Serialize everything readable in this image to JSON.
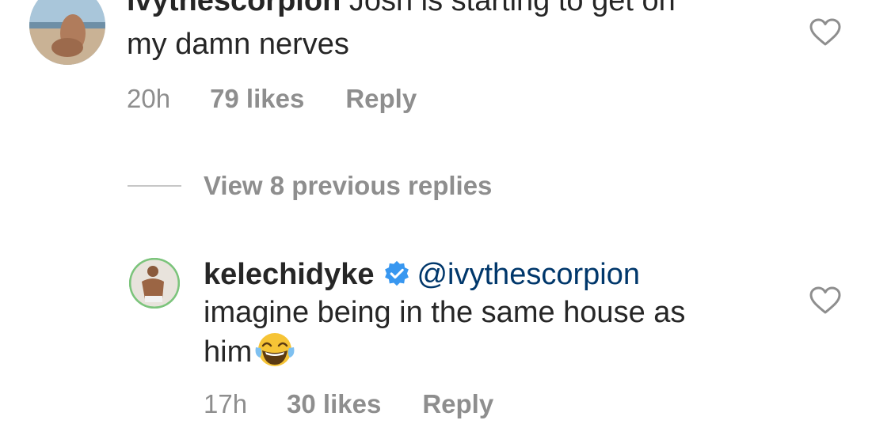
{
  "comment": {
    "username": "ivythescorpion",
    "text_line1": "Josh is starting to get on",
    "text_line2": "my damn nerves",
    "time": "20h",
    "likes": "79 likes",
    "reply_label": "Reply"
  },
  "view_replies": {
    "label": "View 8 previous replies"
  },
  "reply": {
    "username": "kelechidyke",
    "verified": true,
    "mention": "@ivythescorpion",
    "text_line1": "imagine being in the same house as",
    "text_line2": "him",
    "emoji": "face-with-tears-of-joy",
    "time": "17h",
    "likes": "30 likes",
    "reply_label": "Reply"
  },
  "colors": {
    "text": "#262626",
    "meta": "#8e8e8e",
    "mention": "#00376b",
    "verified": "#3897f0",
    "avatar_ring": "#7bc47b"
  }
}
